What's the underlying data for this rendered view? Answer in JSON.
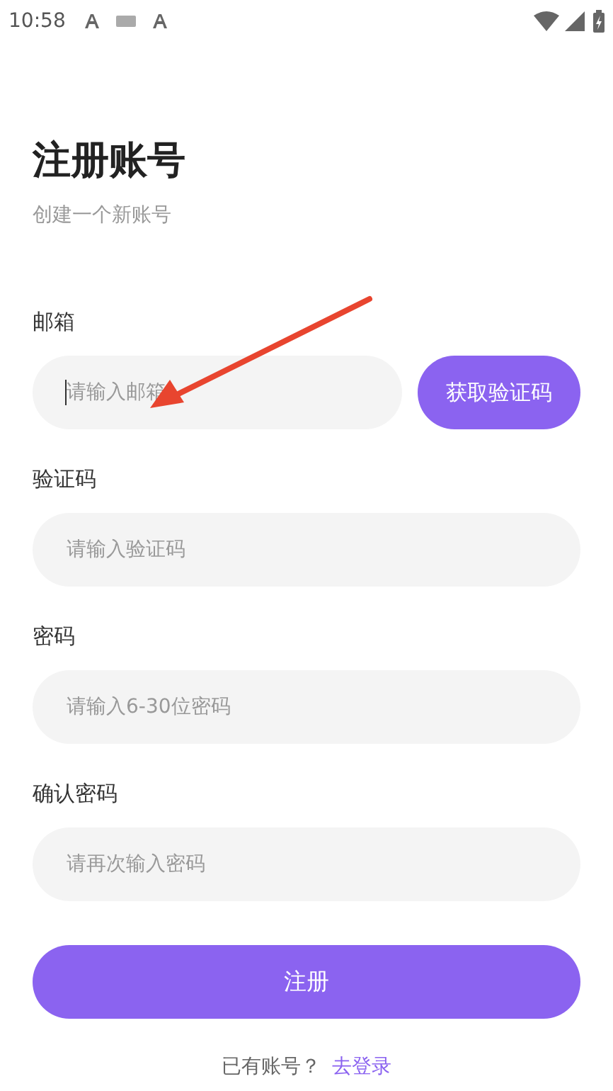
{
  "status_bar": {
    "time": "10:58"
  },
  "title": "注册账号",
  "subtitle": "创建一个新账号",
  "fields": [
    {
      "label": "邮箱",
      "placeholder": "请输入邮箱",
      "focused": true,
      "button": "获取验证码"
    },
    {
      "label": "验证码",
      "placeholder": "请输入验证码",
      "focused": false
    },
    {
      "label": "密码",
      "placeholder": "请输入6-30位密码",
      "focused": false
    },
    {
      "label": "确认密码",
      "placeholder": "请再次输入密码",
      "focused": false
    }
  ],
  "submit": "注册",
  "footer": {
    "text": "已有账号？",
    "link": "去登录"
  }
}
